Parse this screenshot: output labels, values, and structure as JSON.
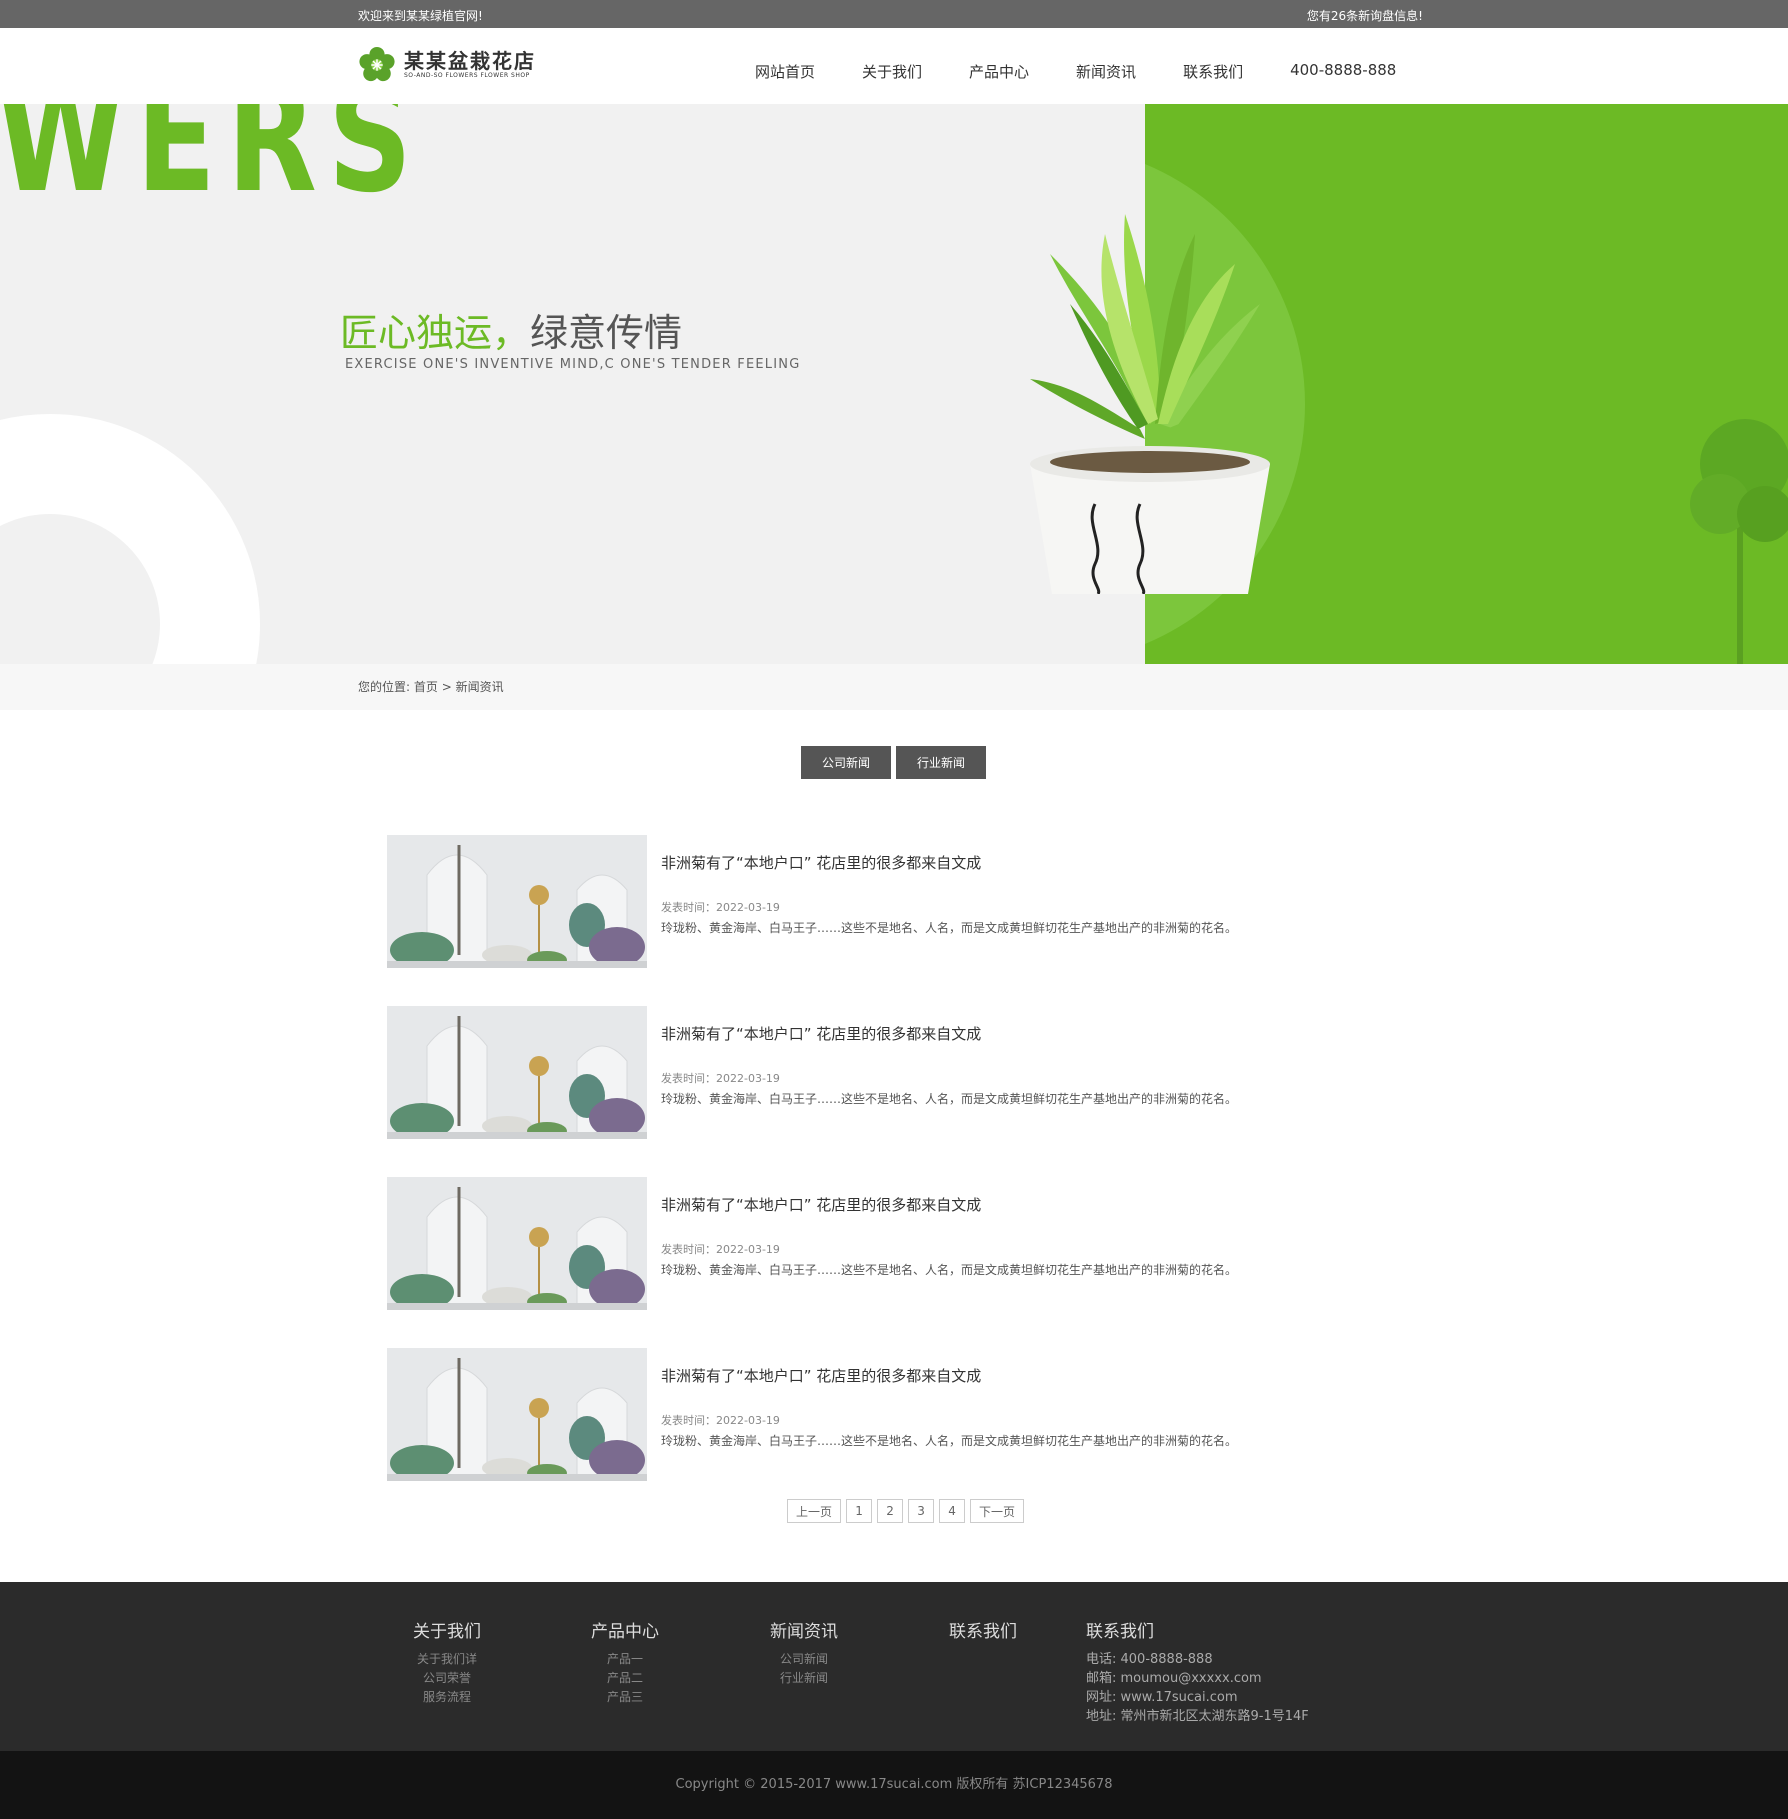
{
  "topbar": {
    "welcome": "欢迎来到某某绿植官网!",
    "messages": "您有26条新询盘信息!"
  },
  "logo": {
    "name": "某某盆栽花店",
    "subtitle": "SO-AND-SO FLOWERS FLOWER SHOP"
  },
  "nav": {
    "items": [
      "网站首页",
      "关于我们",
      "产品中心",
      "新闻资讯",
      "联系我们"
    ],
    "phone": "400-8888-888"
  },
  "banner": {
    "big_text": "WERS",
    "slogan_green": "匠心独运，",
    "slogan_gray": "绿意传情",
    "slogan_en": "EXERCISE ONE'S INVENTIVE MIND,C ONE'S TENDER FEELING"
  },
  "breadcrumb": {
    "label": "您的位置:",
    "home": "首页",
    "sep": ">",
    "current": "新闻资讯"
  },
  "tabs": [
    "公司新闻",
    "行业新闻"
  ],
  "news": [
    {
      "title": "非洲菊有了“本地户口” 花店里的很多都来自文成",
      "date": "发表时间：2022-03-19",
      "desc": "玲珑粉、黄金海岸、白马王子……这些不是地名、人名，而是文成黄坦鲜切花生产基地出产的非洲菊的花名。"
    },
    {
      "title": "非洲菊有了“本地户口” 花店里的很多都来自文成",
      "date": "发表时间：2022-03-19",
      "desc": "玲珑粉、黄金海岸、白马王子……这些不是地名、人名，而是文成黄坦鲜切花生产基地出产的非洲菊的花名。"
    },
    {
      "title": "非洲菊有了“本地户口” 花店里的很多都来自文成",
      "date": "发表时间：2022-03-19",
      "desc": "玲珑粉、黄金海岸、白马王子……这些不是地名、人名，而是文成黄坦鲜切花生产基地出产的非洲菊的花名。"
    },
    {
      "title": "非洲菊有了“本地户口” 花店里的很多都来自文成",
      "date": "发表时间：2022-03-19",
      "desc": "玲珑粉、黄金海岸、白马王子……这些不是地名、人名，而是文成黄坦鲜切花生产基地出产的非洲菊的花名。"
    }
  ],
  "pager": {
    "prev": "上一页",
    "pages": [
      "1",
      "2",
      "3",
      "4"
    ],
    "next": "下一页"
  },
  "footer": {
    "columns": [
      {
        "title": "关于我们",
        "links": [
          "关于我们详",
          "公司荣誉",
          "服务流程"
        ]
      },
      {
        "title": "产品中心",
        "links": [
          "产品一",
          "产品二",
          "产品三"
        ]
      },
      {
        "title": "新闻资讯",
        "links": [
          "公司新闻",
          "行业新闻"
        ]
      },
      {
        "title": "联系我们",
        "links": []
      }
    ],
    "contact": {
      "title": "联系我们",
      "lines": [
        "电话: 400-8888-888",
        "邮箱: moumou@xxxxx.com",
        "网址: www.17sucai.com",
        "地址: 常州市新北区太湖东路9-1号14F"
      ]
    },
    "copyright": "Copyright © 2015-2017 www.17sucai.com 版权所有 苏ICP12345678"
  },
  "colors": {
    "accent_green": "#6cba25",
    "topbar_gray": "#666666",
    "tab_gray": "#555555",
    "footer_dark": "#2b2b2b",
    "copyright_dark": "#131313"
  },
  "icons": {
    "logo": "flower-icon"
  }
}
